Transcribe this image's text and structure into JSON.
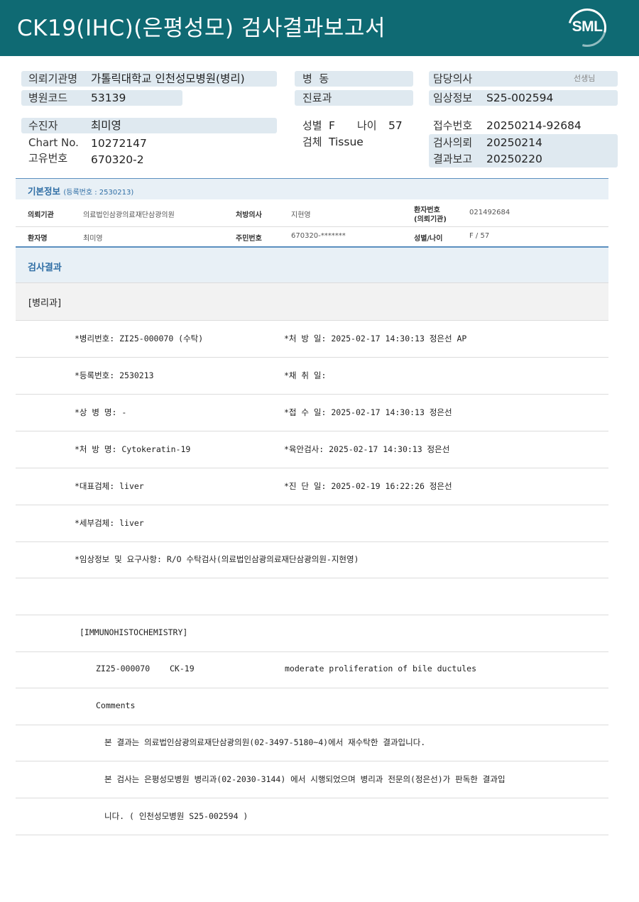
{
  "header": {
    "title": "CK19(IHC)(은평성모) 검사결과보고서",
    "logo_text": "SML",
    "bg_color": "#0f6a73"
  },
  "top": {
    "req_org_label": "의뢰기관명",
    "req_org": "가톨릭대학교 인천성모병원(병리)",
    "hosp_code_label": "병원코드",
    "hosp_code": "53139",
    "ward_label": "병  동",
    "dept_label": "진료과",
    "doctor_label": "담당의사",
    "doctor_suffix": "선생님",
    "clinical_label": "임상정보",
    "clinical": "S25-002594",
    "patient_label": "수진자",
    "patient": "최미영",
    "chart_label": "Chart No.",
    "chart": "10272147",
    "uid_label": "고유번호",
    "uid": "670320-2",
    "sex_label": "성별",
    "sex": "F",
    "age_label": "나이",
    "age": "57",
    "specimen_label": "검체",
    "specimen": "Tissue",
    "receipt_label": "접수번호",
    "receipt": "20250214-92684",
    "request_label": "검사의뢰",
    "request": "20250214",
    "report_label": "결과보고",
    "report": "20250220"
  },
  "basic": {
    "title": "기본정보",
    "reg_no": "(등록번호 : 2530213)",
    "org_label": "의뢰기관",
    "org": "의료법인삼광의료재단삼광의원",
    "prescriber_label": "처방의사",
    "prescriber": "지현영",
    "ptno_label_1": "환자번호",
    "ptno_label_2": "(의뢰기관)",
    "ptno": "021492684",
    "name_label": "환자명",
    "name": "최미영",
    "rrn_label": "주민번호",
    "rrn": "670320-*******",
    "sexage_label": "성별/나이",
    "sexage": "F / 57"
  },
  "results": {
    "title": "검사결과",
    "dept": "[병리과]",
    "rows": [
      {
        "left": "*병리번호: ZI25-000070 (수탁)",
        "right": "*처 방 일: 2025-02-17 14:30:13  정은선 AP"
      },
      {
        "left": "*등록번호: 2530213",
        "right": "*채 취 일:"
      },
      {
        "left": "*상 병 명: -",
        "right": "*접 수 일: 2025-02-17 14:30:13  정은선"
      },
      {
        "left": "*처 방 명: Cytokeratin-19",
        "right": "*육안검사: 2025-02-17 14:30:13  정은선"
      },
      {
        "left": "*대표검체: liver",
        "right": "*진 단 일: 2025-02-19 16:22:26  정은선"
      },
      {
        "left": "*세부검체: liver",
        "right": ""
      }
    ],
    "clinical_req": "*임상정보 및 요구사항: R/O 수탁검사(의료법인삼광의료재단삼광의원-지현영)",
    "ihc_header": "[IMMUNOHISTOCHEMISTRY]",
    "ihc_id": "ZI25-000070",
    "ihc_marker": "CK-19",
    "ihc_result": "moderate proliferation of bile ductules",
    "comments_label": "Comments",
    "comment_1": "본 결과는 의료법인삼광의료재단삼광의원(02-3497-5180~4)에서 재수탁한 결과입니다.",
    "comment_2": "본 검사는 은평성모병원 병리과(02-2030-3144) 에서 시행되었으며 병리과 전문의(정은선)가 판독한 결과입",
    "comment_3": "니다. ( 인천성모병원 S25-002594 )"
  }
}
